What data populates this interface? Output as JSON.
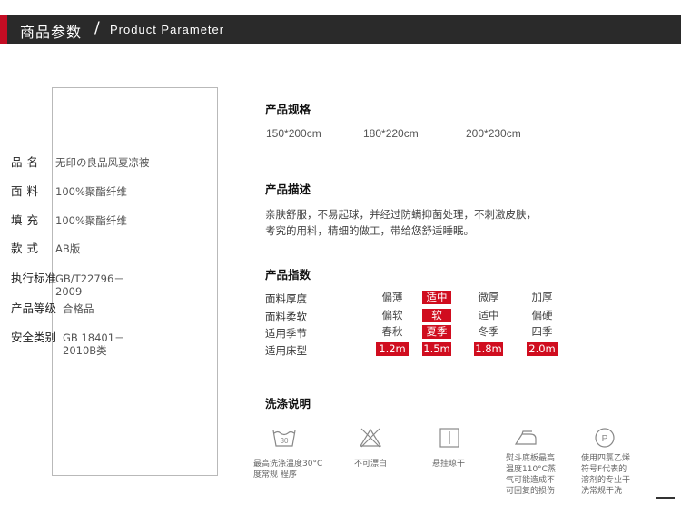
{
  "header": {
    "title_cn": "商品参数",
    "separator": "/",
    "title_en": "Product Parameter"
  },
  "specs": [
    {
      "label": "品名",
      "value": "无印の良品风夏凉被"
    },
    {
      "label": "面料",
      "value": "100%聚酯纤维"
    },
    {
      "label": "填充",
      "value": "100%聚酯纤维"
    },
    {
      "label": "款式",
      "value": "AB版"
    },
    {
      "label": "执行标准",
      "value": "GB/T22796－2009"
    },
    {
      "label": "产品等级",
      "value": "合格品"
    },
    {
      "label": "安全类别",
      "value": "GB 18401－2010B类"
    }
  ],
  "size_section": {
    "title": "产品规格",
    "sizes": [
      "150*200cm",
      "180*220cm",
      "200*230cm"
    ]
  },
  "desc_section": {
    "title": "产品描述",
    "line1": "亲肤舒服，不易起球，并经过防螨抑菌处理，不刺激皮肤，",
    "line2": "考究的用料，精细的做工，带给您舒适睡眠。"
  },
  "index_section": {
    "title": "产品指数",
    "rows": [
      {
        "label": "面料厚度",
        "options": [
          "偏薄",
          "适中",
          "微厚",
          "加厚"
        ],
        "selected": [
          1
        ]
      },
      {
        "label": "面料柔软",
        "options": [
          "偏软",
          "软",
          "适中",
          "偏硬"
        ],
        "selected": [
          1
        ]
      },
      {
        "label": "适用季节",
        "options": [
          "春秋",
          "夏季",
          "冬季",
          "四季"
        ],
        "selected": [
          1
        ]
      },
      {
        "label": "适用床型",
        "options": [
          "1.2m",
          "1.5m",
          "1.8m",
          "2.0m"
        ],
        "selected": [
          0,
          1,
          2,
          3
        ]
      }
    ],
    "highlight_color": "#d00d1f"
  },
  "care_section": {
    "title": "洗涤说明",
    "items": [
      {
        "icon": "wash-30-icon",
        "icon_text": "30",
        "text": [
          "最高洗涤温度30°C",
          "度常规 程序"
        ]
      },
      {
        "icon": "no-bleach-icon",
        "text": [
          "不可漂白"
        ]
      },
      {
        "icon": "hang-dry-icon",
        "text": [
          "悬挂晾干"
        ]
      },
      {
        "icon": "iron-icon",
        "text": [
          "熨斗底板最高",
          "温度110°C蒸",
          "气可能造成不",
          "可回复的损伤"
        ]
      },
      {
        "icon": "dry-clean-p-icon",
        "icon_text": "P",
        "text": [
          "使用四氯乙烯",
          "符号F代表的",
          "溶剂的专业干",
          "洗常规干洗"
        ]
      }
    ]
  }
}
